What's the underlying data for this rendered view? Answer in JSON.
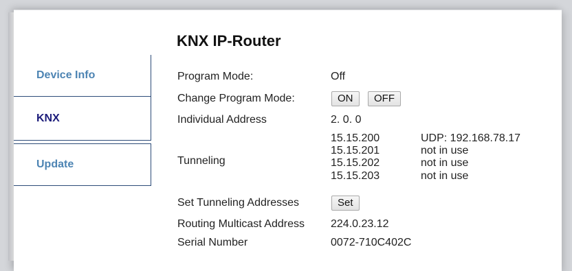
{
  "app": {
    "title": "KNX IP-Router"
  },
  "sidebar": {
    "items": [
      {
        "label": "Device Info",
        "active": false
      },
      {
        "label": "KNX",
        "active": true
      },
      {
        "label": "Update",
        "active": false
      }
    ]
  },
  "colors": {
    "nav_link": "#4d84b3",
    "nav_active": "#1c1c7a",
    "nav_border": "#2b4a77"
  },
  "knx": {
    "program_mode": {
      "label": "Program Mode:",
      "value": "Off"
    },
    "change_program_mode": {
      "label": "Change Program Mode:",
      "on_button": "ON",
      "off_button": "OFF"
    },
    "individual_address": {
      "label": "Individual Address",
      "value": "2. 0. 0"
    },
    "tunneling": {
      "label": "Tunneling",
      "entries": [
        {
          "address": "15.15.200",
          "status": "UDP: 192.168.78.17"
        },
        {
          "address": "15.15.201",
          "status": "not in use"
        },
        {
          "address": "15.15.202",
          "status": "not in use"
        },
        {
          "address": "15.15.203",
          "status": "not in use"
        }
      ]
    },
    "set_tunneling": {
      "label": "Set Tunneling Addresses",
      "button": "Set"
    },
    "routing_multicast": {
      "label": "Routing Multicast Address",
      "value": "224.0.23.12"
    },
    "serial_number": {
      "label": "Serial Number",
      "value": "0072-710C402C"
    }
  }
}
